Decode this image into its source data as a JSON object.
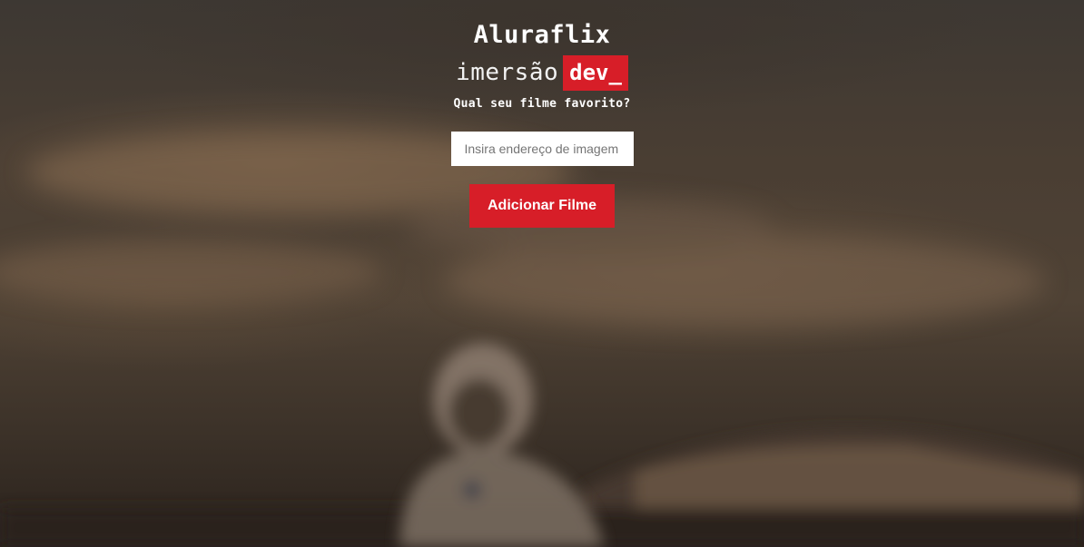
{
  "header": {
    "title": "Aluraflix",
    "brand_word": "imersão",
    "brand_tag": "dev_",
    "subtitle": "Qual seu filme favorito?"
  },
  "form": {
    "image_url_input": {
      "value": "",
      "placeholder": "Insira endereço de imagem"
    },
    "add_button_label": "Adicionar Filme"
  },
  "colors": {
    "accent": "#d71e28",
    "text": "#ffffff",
    "input_background": "#ffffff"
  }
}
